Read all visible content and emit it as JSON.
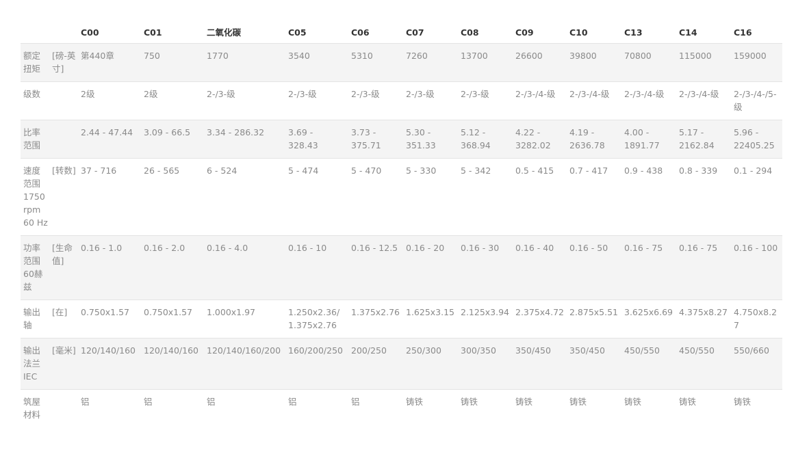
{
  "columns": [
    "C00",
    "C01",
    "二氧化碳",
    "C05",
    "C06",
    "C07",
    "C08",
    "C09",
    "C10",
    "C13",
    "C14",
    "C16"
  ],
  "rows": [
    {
      "param": "额定扭矩",
      "unit": "[磅-英寸]",
      "values": [
        "第440章",
        "750",
        "1770",
        "3540",
        "5310",
        "7260",
        "13700",
        "26600",
        "39800",
        "70800",
        "115000",
        "159000"
      ]
    },
    {
      "param": "级数",
      "unit": "",
      "values": [
        "2级",
        "2级",
        "2-/3-级",
        "2-/3-级",
        "2-/3-级",
        "2-/3-级",
        "2-/3-级",
        "2-/3-/4-级",
        "2-/3-/4-级",
        "2-/3-/4-级",
        "2-/3-/4-级",
        "2-/3-/4-/5-级"
      ]
    },
    {
      "param": "比率范围",
      "unit": "",
      "values": [
        "2.44 - 47.44",
        "3.09 - 66.5",
        "3.34 - 286.32",
        "3.69 - 328.43",
        "3.73 - 375.71",
        "5.30 - 351.33",
        "5.12 - 368.94",
        "4.22 - 3282.02",
        "4.19 - 2636.78",
        "4.00 - 1891.77",
        "5.17 - 2162.84",
        "5.96 - 22405.25"
      ]
    },
    {
      "param": "速度范围1750 rpm 60 Hz",
      "unit": "[转数]",
      "values": [
        "37 - 716",
        "26 - 565",
        "6 - 524",
        "5 - 474",
        "5 - 470",
        "5 - 330",
        "5 - 342",
        "0.5 - 415",
        "0.7 - 417",
        "0.9 - 438",
        "0.8 - 339",
        "0.1 - 294"
      ]
    },
    {
      "param": "功率范围60赫兹",
      "unit": "[生命值]",
      "values": [
        "0.16 - 1.0",
        "0.16 - 2.0",
        "0.16 - 4.0",
        "0.16 - 10",
        "0.16 - 12.5",
        "0.16 - 20",
        "0.16 - 30",
        "0.16 - 40",
        "0.16 - 50",
        "0.16 - 75",
        "0.16 - 75",
        "0.16 - 100"
      ]
    },
    {
      "param": "输出轴",
      "unit": "[在]",
      "values": [
        "0.750x1.57",
        "0.750x1.57",
        "1.000x1.97",
        "1.250x2.36/ 1.375x2.76",
        "1.375x2.76",
        "1.625x3.15",
        "2.125x3.94",
        "2.375x4.72",
        "2.875x5.51",
        "3.625x6.69",
        "4.375x8.27",
        "4.750x8.27"
      ]
    },
    {
      "param": "输出法兰IEC",
      "unit": "[毫米]",
      "values": [
        "120/140/160",
        "120/140/160",
        "120/140/160/200",
        "160/200/250",
        "200/250",
        "250/300",
        "300/350",
        "350/450",
        "350/450",
        "450/550",
        "450/550",
        "550/660"
      ]
    },
    {
      "param": "筑屋材料",
      "unit": "",
      "values": [
        "铝",
        "铝",
        "铝",
        "铝",
        "铝",
        "铸铁",
        "铸铁",
        "铸铁",
        "铸铁",
        "铸铁",
        "铸铁",
        "铸铁"
      ]
    }
  ]
}
